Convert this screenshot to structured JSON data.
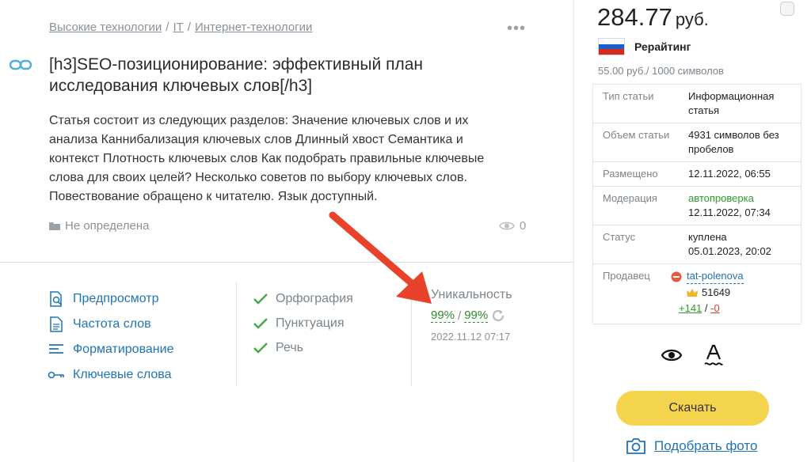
{
  "breadcrumb": {
    "items": [
      "Высокие технологии",
      "IT",
      "Интернет-технологии"
    ],
    "separator": "/"
  },
  "more_label": "•••",
  "article": {
    "title": "[h3]SEO-позиционирование: эффективный план исследования ключевых слов[/h3]",
    "description": "Статья состоит из следующих разделов: Значение ключевых слов и их анализа Каннибализация ключевых слов Длинный хвост Семантика и контекст Плотность ключевых слов Как подобрать правильные ключевые слова для своих целей? Несколько советов по выбору ключевых слов. Повествование обращено к читателю. Язык доступный.",
    "category": "Не определена",
    "views": "0"
  },
  "tools": [
    {
      "label": "Предпросмотр",
      "icon": "preview-icon"
    },
    {
      "label": "Частота слов",
      "icon": "document-icon"
    },
    {
      "label": "Форматирование",
      "icon": "format-icon"
    },
    {
      "label": "Ключевые слова",
      "icon": "key-icon"
    }
  ],
  "checks": [
    "Орфография",
    "Пунктуация",
    "Речь"
  ],
  "uniqueness": {
    "title": "Уникальность",
    "value1": "99%",
    "value2": "99%",
    "separator": "/",
    "date": "2022.11.12 07:17"
  },
  "sidebar": {
    "price": "284.77",
    "currency": "руб.",
    "site": "Рерайтинг",
    "rate": "55.00 руб./ 1000 символов",
    "rows": {
      "type": {
        "k": "Тип статьи",
        "v": "Информационная статья"
      },
      "size": {
        "k": "Объем статьи",
        "v": "4931 символов без пробелов"
      },
      "placed": {
        "k": "Размещено",
        "v": "12.11.2022, 06:55"
      },
      "moderation": {
        "k": "Модерация",
        "v1": "автопроверка",
        "v2": "12.11.2022, 07:34"
      },
      "status": {
        "k": "Статус",
        "v1": "куплена",
        "v2": "05.01.2023, 20:02"
      },
      "seller": {
        "k": "Продавец",
        "name": "tat-polenova",
        "rating": "51649",
        "plus": "+141",
        "sep": "/",
        "minus": "-0"
      }
    },
    "download_label": "Скачать",
    "photo_label": "Подобрать фото"
  },
  "colors": {
    "link": "#1f73b7",
    "green": "#2e9b2e",
    "red": "#d23f2f",
    "button": "#f5d44d",
    "arrow": "#e8432a"
  }
}
